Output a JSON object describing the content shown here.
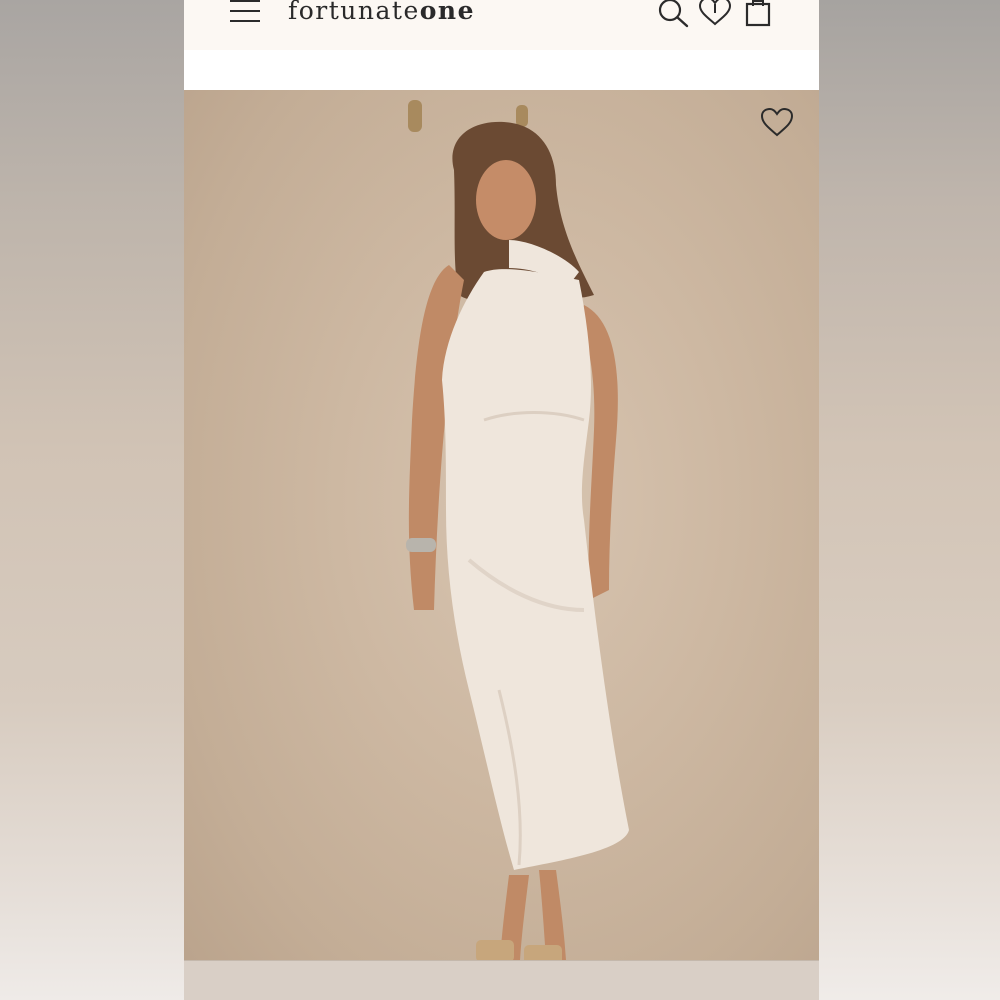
{
  "header": {
    "logo_regular": "fortunate",
    "logo_bold": "one",
    "icons": [
      "menu-icon",
      "search-icon",
      "heart-icon",
      "bag-icon"
    ]
  },
  "product_image": {
    "description_icon": "wishlist-heart-icon"
  },
  "colors": {
    "header_bg": "#fcf8f3",
    "backdrop": "#cdb8a2",
    "dress": "#efe6dc",
    "icon_stroke": "#2b2b2b"
  }
}
